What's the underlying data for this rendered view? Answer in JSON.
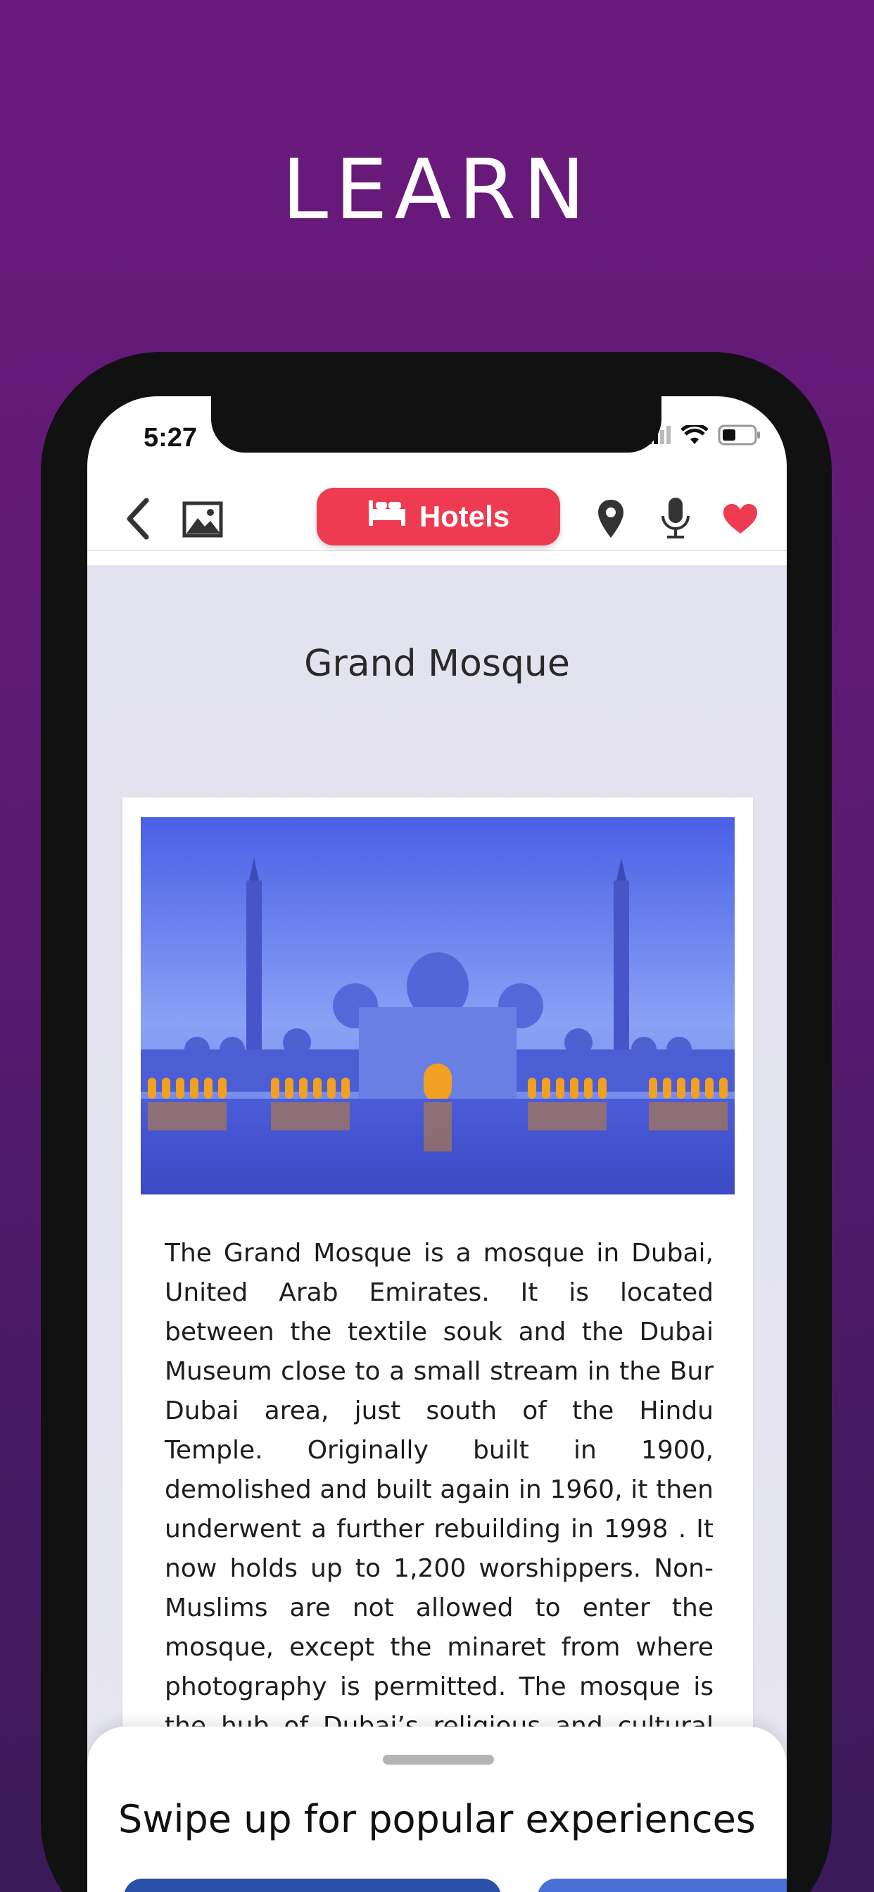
{
  "headline": "LEARN",
  "status_bar": {
    "time": "5:27"
  },
  "nav": {
    "hotels_label": "Hotels"
  },
  "place": {
    "title": "Grand Mosque",
    "description": "The Grand Mosque is a mosque in Dubai, United Arab Emirates. It is located between the textile souk and the Dubai Museum close to a small stream in the Bur Dubai area, just south of the Hindu Temple. Originally built in 1900, demolished and built again in 1960, it then underwent a further rebuilding in 1998 . It now holds up to 1,200 worshippers. Non-Muslims are not allowed to enter the mosque, except the minaret from where photography is permitted. The mosque is the hub of Dubai’s religious and cultural life."
  },
  "sheet": {
    "title": "Swipe up for popular experiences"
  },
  "colors": {
    "background": "#6c1a7c",
    "accent": "#ef3b52",
    "heart": "#ef3b52"
  },
  "icons": [
    "back-chevron-icon",
    "image-icon",
    "bed-icon",
    "location-pin-icon",
    "microphone-icon",
    "heart-icon",
    "signal-icon",
    "wifi-icon",
    "battery-icon"
  ]
}
